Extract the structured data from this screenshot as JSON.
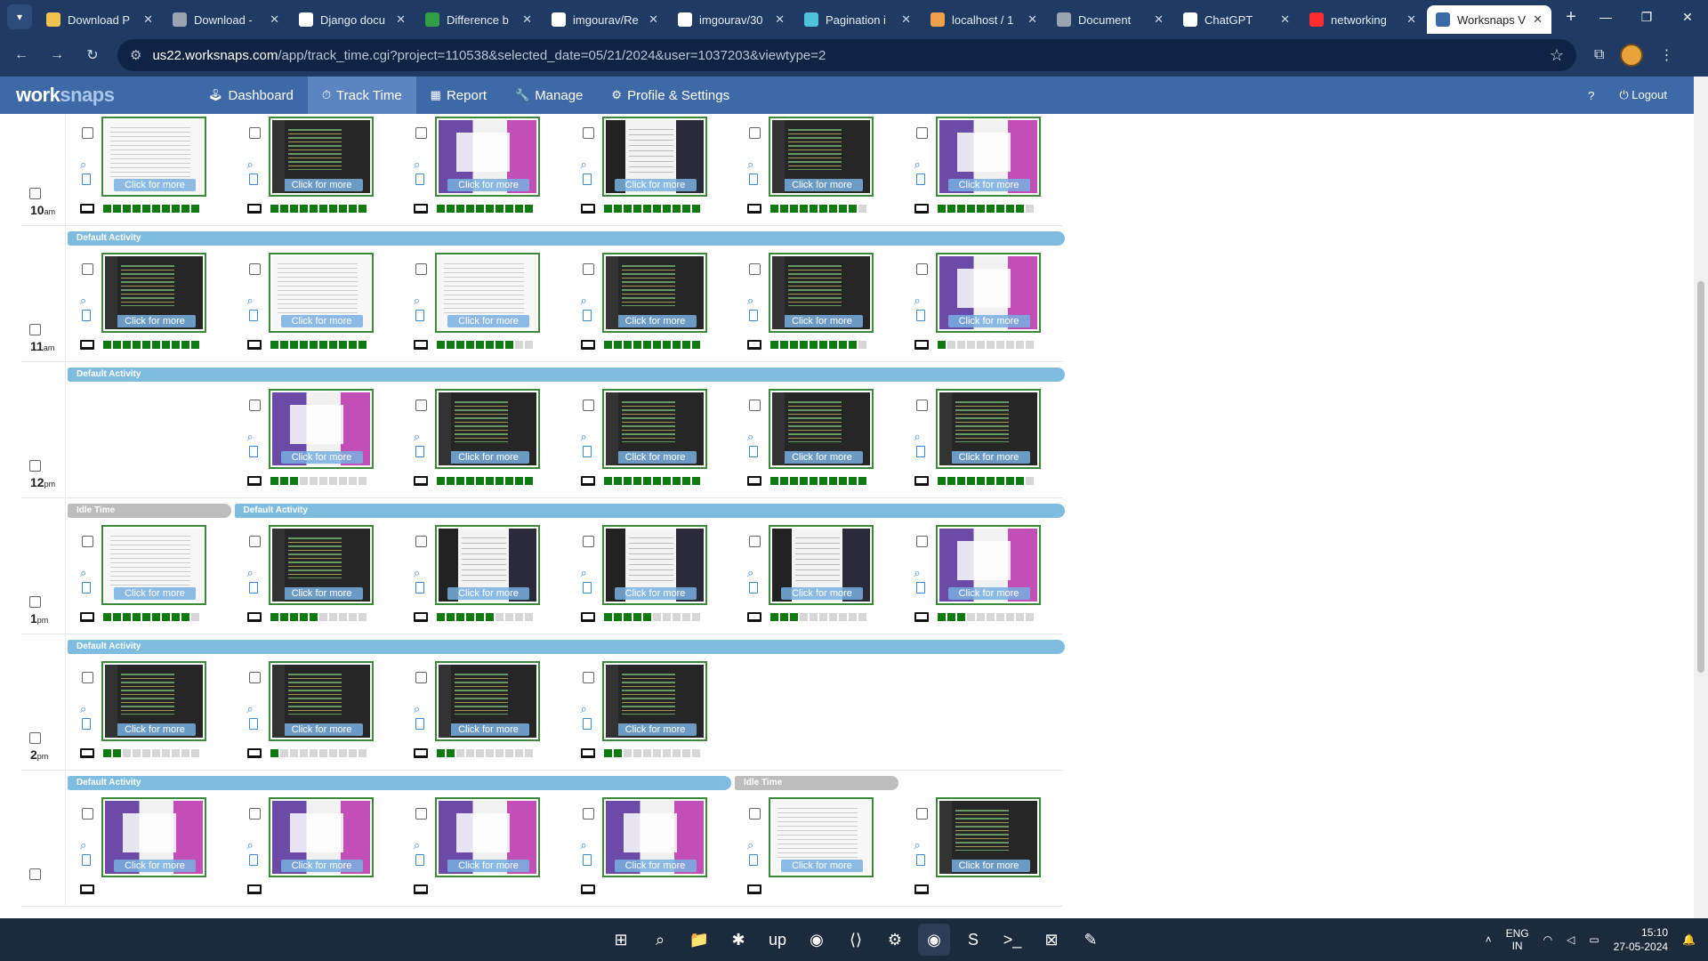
{
  "browser": {
    "tabs": [
      {
        "title": "Download P",
        "color": "#f2c14e"
      },
      {
        "title": "Download -",
        "color": "#9aa5b1"
      },
      {
        "title": "Django docu",
        "color": "#ffffff"
      },
      {
        "title": "Difference b",
        "color": "#2f9e44"
      },
      {
        "title": "imgourav/Re",
        "color": "#ffffff"
      },
      {
        "title": "imgourav/30",
        "color": "#ffffff"
      },
      {
        "title": "Pagination i",
        "color": "#4fc3d9"
      },
      {
        "title": "localhost / 1",
        "color": "#f0a04b"
      },
      {
        "title": "Document",
        "color": "#9aa5b1"
      },
      {
        "title": "ChatGPT",
        "color": "#ffffff"
      },
      {
        "title": "networking",
        "color": "#ff2d2d"
      },
      {
        "title": "Worksnaps V",
        "color": "#3d6aa7"
      }
    ],
    "url_site": "us22.worksnaps.com",
    "url_rest": "/app/track_time.cgi?project=110538&selected_date=05/21/2024&user=1037203&viewtype=2"
  },
  "app": {
    "logo_a": "work",
    "logo_b": "snaps",
    "nav": [
      {
        "label": "Dashboard",
        "icon": "dashboard-icon",
        "glyph": "🕹"
      },
      {
        "label": "Track Time",
        "icon": "clock-icon",
        "glyph": "⏱"
      },
      {
        "label": "Report",
        "icon": "chart-icon",
        "glyph": "▦"
      },
      {
        "label": "Manage",
        "icon": "wrench-icon",
        "glyph": "🔧"
      },
      {
        "label": "Profile & Settings",
        "icon": "gear-icon",
        "glyph": "⚙"
      }
    ],
    "help_label": "?",
    "logout_label": "Logout"
  },
  "click_for_more": "Click for more",
  "hours": [
    {
      "label": "10",
      "suffix": "am",
      "bands": [
        {
          "label": "Default Activity",
          "type": "default",
          "from": 4,
          "to": 6
        }
      ],
      "slots": [
        {
          "col": 0,
          "shot": "light",
          "level": 10
        },
        {
          "col": 1,
          "shot": "dark",
          "level": 10
        },
        {
          "col": 2,
          "shot": "purple",
          "level": 10
        },
        {
          "col": 3,
          "shot": "mixed",
          "level": 10
        },
        {
          "col": 4,
          "shot": "dark",
          "level": 9
        },
        {
          "col": 5,
          "shot": "purple",
          "level": 9
        }
      ]
    },
    {
      "label": "11",
      "suffix": "am",
      "bands": [
        {
          "label": "Default Activity",
          "type": "default",
          "from": 0,
          "to": 6
        }
      ],
      "slots": [
        {
          "col": 0,
          "shot": "dark",
          "level": 10
        },
        {
          "col": 1,
          "shot": "light",
          "level": 10
        },
        {
          "col": 2,
          "shot": "light",
          "level": 8
        },
        {
          "col": 3,
          "shot": "dark",
          "level": 10
        },
        {
          "col": 4,
          "shot": "dark",
          "level": 9
        },
        {
          "col": 5,
          "shot": "purple",
          "level": 1
        }
      ]
    },
    {
      "label": "12",
      "suffix": "pm",
      "bands": [
        {
          "label": "Default Activity",
          "type": "default",
          "from": 0,
          "to": 6
        }
      ],
      "slots": [
        {
          "col": 1,
          "shot": "purple",
          "level": 3
        },
        {
          "col": 2,
          "shot": "dark",
          "level": 10
        },
        {
          "col": 3,
          "shot": "dark",
          "level": 10
        },
        {
          "col": 4,
          "shot": "dark",
          "level": 10
        },
        {
          "col": 5,
          "shot": "dark",
          "level": 9
        }
      ]
    },
    {
      "label": "1",
      "suffix": "pm",
      "bands": [
        {
          "label": "Idle Time",
          "type": "idle",
          "from": 0,
          "to": 1
        },
        {
          "label": "Default Activity",
          "type": "default",
          "from": 1,
          "to": 6
        }
      ],
      "slots": [
        {
          "col": 0,
          "shot": "light",
          "level": 9
        },
        {
          "col": 1,
          "shot": "dark",
          "level": 5
        },
        {
          "col": 2,
          "shot": "mixed",
          "level": 6
        },
        {
          "col": 3,
          "shot": "mixed",
          "level": 5
        },
        {
          "col": 4,
          "shot": "mixed",
          "level": 3
        },
        {
          "col": 5,
          "shot": "purple",
          "level": 3
        }
      ]
    },
    {
      "label": "2",
      "suffix": "pm",
      "bands": [
        {
          "label": "Default Activity",
          "type": "default",
          "from": 0,
          "to": 6
        }
      ],
      "slots": [
        {
          "col": 0,
          "shot": "dark",
          "level": 2
        },
        {
          "col": 1,
          "shot": "dark",
          "level": 1
        },
        {
          "col": 2,
          "shot": "dark",
          "level": 2
        },
        {
          "col": 3,
          "shot": "dark",
          "level": 2
        }
      ]
    },
    {
      "label": "",
      "suffix": "",
      "bands": [
        {
          "label": "Default Activity",
          "type": "default",
          "from": 0,
          "to": 4
        },
        {
          "label": "Idle Time",
          "type": "idle",
          "from": 4,
          "to": 5
        }
      ],
      "slots": [
        {
          "col": 0,
          "shot": "purple",
          "level": 0
        },
        {
          "col": 1,
          "shot": "purple",
          "level": 0
        },
        {
          "col": 2,
          "shot": "purple",
          "level": 0
        },
        {
          "col": 3,
          "shot": "purple",
          "level": 0
        },
        {
          "col": 4,
          "shot": "light",
          "level": 0
        },
        {
          "col": 5,
          "shot": "dark",
          "level": 0
        }
      ]
    }
  ],
  "taskbar": {
    "apps": [
      {
        "name": "start-icon",
        "glyph": "⊞"
      },
      {
        "name": "search-icon",
        "glyph": "⌕"
      },
      {
        "name": "file-explorer-icon",
        "glyph": "📁"
      },
      {
        "name": "slack-icon",
        "glyph": "✱"
      },
      {
        "name": "upwork-icon",
        "glyph": "up"
      },
      {
        "name": "chrome-icon",
        "glyph": "◉"
      },
      {
        "name": "vscode-icon",
        "glyph": "⟨⟩"
      },
      {
        "name": "settings-icon",
        "glyph": "⚙"
      },
      {
        "name": "chrome-active-icon",
        "glyph": "◉"
      },
      {
        "name": "sublime-icon",
        "glyph": "S"
      },
      {
        "name": "terminal-icon",
        "glyph": ">_"
      },
      {
        "name": "xampp-icon",
        "glyph": "⊠"
      },
      {
        "name": "paint-icon",
        "glyph": "✎"
      }
    ],
    "lang_top": "ENG",
    "lang_bottom": "IN",
    "time": "15:10",
    "date": "27-05-2024"
  }
}
